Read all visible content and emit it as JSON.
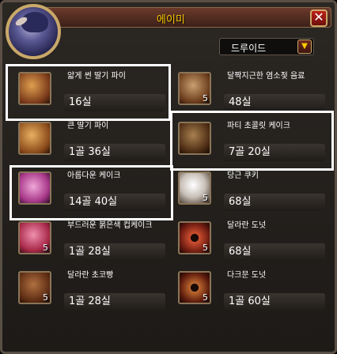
{
  "window": {
    "title": "에이미"
  },
  "filter": {
    "selected": "드루이드"
  },
  "items": [
    {
      "name": "얇게 썬 딸기 파이",
      "price": "16실",
      "count": "",
      "icon": "strawberry-pie-slice-icon",
      "color": "#b76a2a"
    },
    {
      "name": "달짝지근한 염소젖 음료",
      "price": "48실",
      "count": "5",
      "icon": "goat-milk-icon",
      "color": "#8a5a3a"
    },
    {
      "name": "큰 딸기 파이",
      "price": "1골 36실",
      "count": "",
      "icon": "strawberry-pie-icon",
      "color": "#c4783a"
    },
    {
      "name": "파티 초콜릿 케이크",
      "price": "7골 20실",
      "count": "",
      "icon": "chocolate-cake-icon",
      "color": "#6a4a2a"
    },
    {
      "name": "아름다운 케이크",
      "price": "14골 40실",
      "count": "",
      "icon": "pink-cake-icon",
      "color": "#c45a9a"
    },
    {
      "name": "당근 쿠키",
      "price": "68실",
      "count": "5",
      "icon": "carrot-cookie-icon",
      "color": "#d8d0c8"
    },
    {
      "name": "부드러운 붉은색 컵케이크",
      "price": "1골 28실",
      "count": "5",
      "icon": "red-cupcake-icon",
      "color": "#b83a5a"
    },
    {
      "name": "달라란 도넛",
      "price": "68실",
      "count": "5",
      "icon": "donut-icon",
      "color": "#b0402a"
    },
    {
      "name": "달라란 초코빵",
      "price": "1골 28실",
      "count": "5",
      "icon": "chocolate-bread-icon",
      "color": "#8a4a2a"
    },
    {
      "name": "다크문 도넛",
      "price": "1골 60실",
      "count": "5",
      "icon": "darkmoon-donut-icon",
      "color": "#8a3a22"
    }
  ]
}
